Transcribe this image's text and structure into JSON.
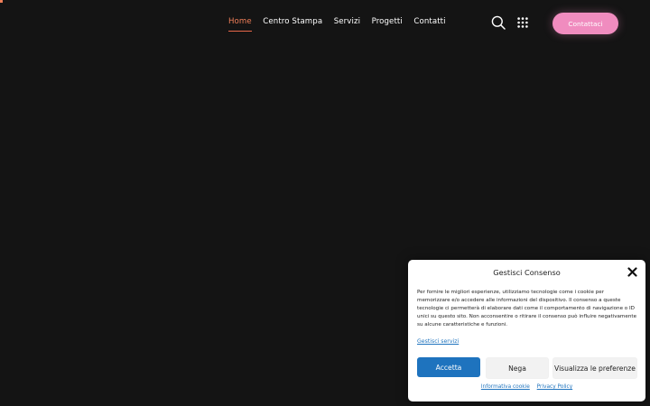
{
  "header": {
    "nav": [
      {
        "label": "Home",
        "active": true
      },
      {
        "label": "Centro Stampa",
        "active": false
      },
      {
        "label": "Servizi",
        "active": false
      },
      {
        "label": "Progetti",
        "active": false
      },
      {
        "label": "Contatti",
        "active": false
      }
    ],
    "cta_label": "Contattaci",
    "icons": [
      "search-icon",
      "grid-menu-icon"
    ]
  },
  "consent": {
    "title": "Gestisci Consenso",
    "body": "Per fornire le migliori esperienze, utilizziamo tecnologie come i cookie per memorizzare e/o accedere alle informazioni del dispositivo. Il consenso a queste tecnologie ci permetterà di elaborare dati come il comportamento di navigazione o ID unici su questo sito. Non acconsentire o ritirare il consenso può influire negativamente su alcune caratteristiche e funzioni.",
    "manage_link": "Gestisci servizi",
    "buttons": {
      "accept": "Accetta",
      "deny": "Nega",
      "preferences": "Visualizza le preferenze"
    },
    "links": {
      "cookie_policy": "Informativa cookie",
      "privacy_policy": "Privacy Policy"
    }
  },
  "colors": {
    "background": "#141414",
    "nav_active": "#f07f59",
    "cta": "#f08cbf",
    "accept_button": "#1e73be"
  }
}
